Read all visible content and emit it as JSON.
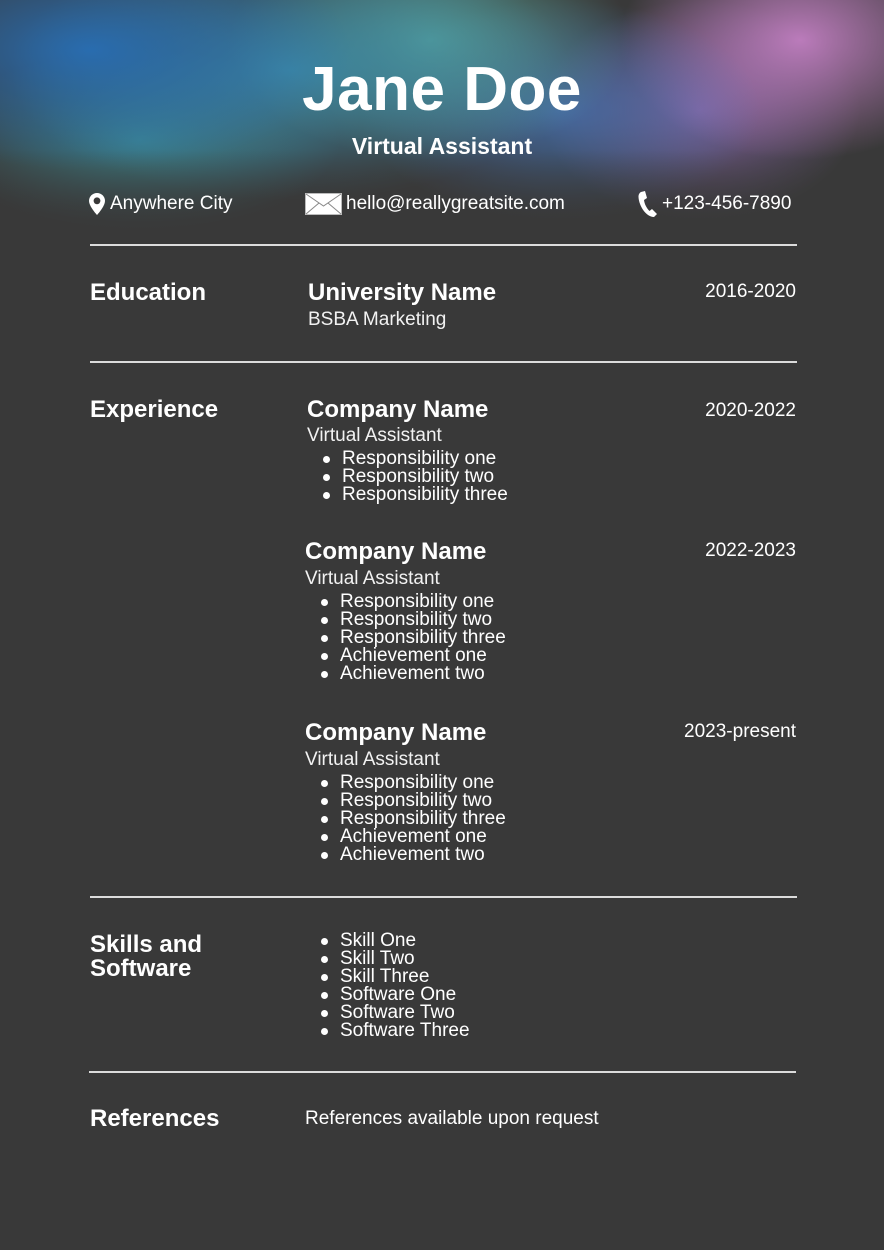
{
  "header": {
    "name": "Jane Doe",
    "title": "Virtual Assistant",
    "contacts": {
      "location": {
        "icon": "location-pin-icon",
        "text": "Anywhere City"
      },
      "email": {
        "icon": "envelope-icon",
        "text": "hello@reallygreatsite.com"
      },
      "phone": {
        "icon": "phone-icon",
        "text": "+123-456-7890"
      }
    }
  },
  "colors": {
    "background": "#393939",
    "text": "#ffffff",
    "gradient_blue": "#2c6fb6",
    "gradient_teal": "#5aa9a0",
    "gradient_pink": "#c884c8"
  },
  "education": {
    "heading": "Education",
    "school": "University Name",
    "degree": "BSBA Marketing",
    "dates": "2016-2020"
  },
  "experience": {
    "heading": "Experience",
    "jobs": [
      {
        "company": "Company Name",
        "role": "Virtual Assistant",
        "dates": "2020-2022",
        "items": [
          "Responsibility one",
          "Responsibility two",
          "Responsibility three"
        ]
      },
      {
        "company": "Company Name",
        "role": "Virtual Assistant",
        "dates": "2022-2023",
        "items": [
          "Responsibility one",
          "Responsibility two",
          "Responsibility three",
          "Achievement one",
          "Achievement two"
        ]
      },
      {
        "company": "Company Name",
        "role": "Virtual Assistant",
        "dates": "2023-present",
        "items": [
          "Responsibility one",
          "Responsibility two",
          "Responsibility three",
          "Achievement one",
          "Achievement two"
        ]
      }
    ]
  },
  "skills": {
    "heading_line1": "Skills and",
    "heading_line2": "Software",
    "items": [
      "Skill One",
      "Skill Two",
      "Skill Three",
      "Software One",
      "Software Two",
      "Software Three"
    ]
  },
  "references": {
    "heading": "References",
    "text": "References available upon request"
  }
}
